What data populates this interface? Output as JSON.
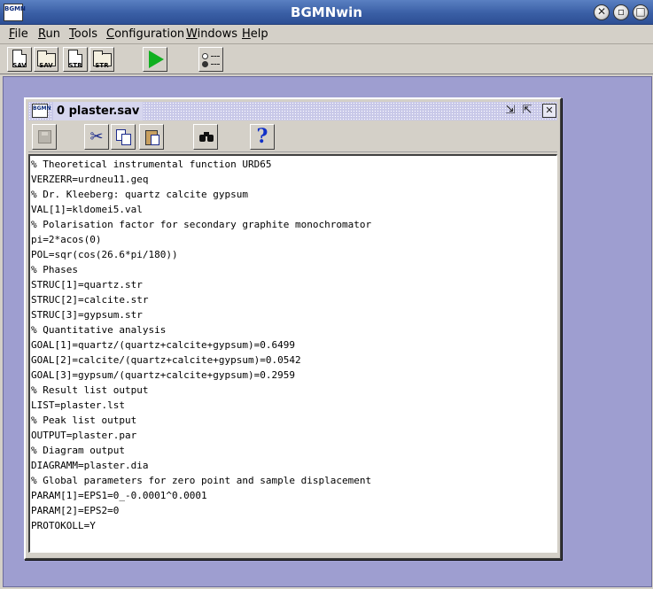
{
  "window": {
    "title": "BGMNwin",
    "icon_label": "BGMN"
  },
  "menu": [
    {
      "mnemonic": "F",
      "rest": "ile"
    },
    {
      "mnemonic": "R",
      "rest": "un"
    },
    {
      "mnemonic": "T",
      "rest": "ools"
    },
    {
      "mnemonic": "C",
      "rest": "onfiguration"
    },
    {
      "mnemonic": "W",
      "rest": "indows"
    },
    {
      "mnemonic": "H",
      "rest": "elp"
    }
  ],
  "toolbar": {
    "new_sav_label": "SAV",
    "open_sav_label": "SAV",
    "new_str_label": "STR",
    "open_str_label": "STR",
    "run_icon": "play-icon",
    "options_icon": "radio-options-icon"
  },
  "frame": {
    "icon_label": "BGMN",
    "title": "0 plaster.sav"
  },
  "editor_toolbar": {
    "save_icon": "floppy-disk-icon",
    "cut_glyph": "✂",
    "find_icon": "binoculars-icon",
    "help_glyph": "?"
  },
  "editor": {
    "lines": [
      "% Theoretical instrumental function URD65",
      "VERZERR=urdneu11.geq",
      "% Dr. Kleeberg: quartz calcite gypsum",
      "VAL[1]=kldomei5.val",
      "% Polarisation factor for secondary graphite monochromator",
      "pi=2*acos(0)",
      "POL=sqr(cos(26.6*pi/180))",
      "% Phases",
      "STRUC[1]=quartz.str",
      "STRUC[2]=calcite.str",
      "STRUC[3]=gypsum.str",
      "% Quantitative analysis",
      "GOAL[1]=quartz/(quartz+calcite+gypsum)=0.6499",
      "GOAL[2]=calcite/(quartz+calcite+gypsum)=0.0542",
      "GOAL[3]=gypsum/(quartz+calcite+gypsum)=0.2959",
      "% Result list output",
      "LIST=plaster.lst",
      "% Peak list output",
      "OUTPUT=plaster.par",
      "% Diagram output",
      "DIAGRAMM=plaster.dia",
      "% Global parameters for zero point and sample displacement",
      "PARAM[1]=EPS1=0_-0.0001^0.0001",
      "PARAM[2]=EPS2=0",
      "PROTOKOLL=Y"
    ]
  },
  "colors": {
    "desktop": "#9e9ed0",
    "titlebar": "#3a5fa5",
    "panel": "#d4d0c8",
    "run_green": "#10b020",
    "help_blue": "#1030c8"
  }
}
